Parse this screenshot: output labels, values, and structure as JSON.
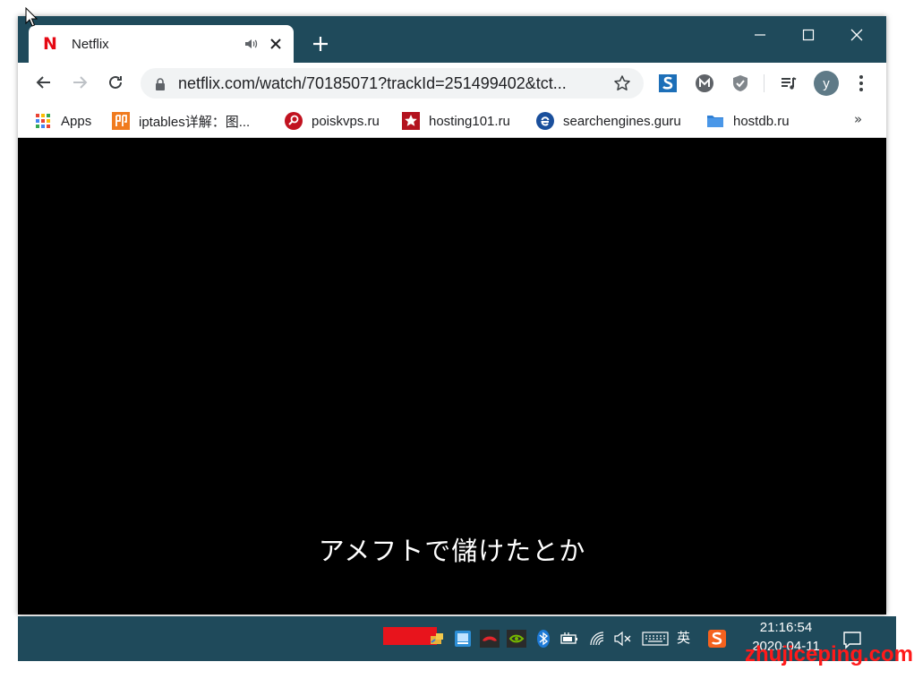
{
  "tab": {
    "title": "Netflix",
    "logo": "N"
  },
  "omnibox": {
    "url": "netflix.com/watch/70185071?trackId=251499402&tct..."
  },
  "profile": {
    "initial": "y"
  },
  "bookmarks": {
    "items": [
      {
        "label": "Apps",
        "icon": "apps-grid-icon"
      },
      {
        "label": "iptables详解：图...",
        "icon": "orange-badge-icon"
      },
      {
        "label": "poiskvps.ru",
        "icon": "red-search-icon"
      },
      {
        "label": "hosting101.ru",
        "icon": "red-star-icon"
      },
      {
        "label": "searchengines.guru",
        "icon": "blue-e-icon"
      },
      {
        "label": "hostdb.ru",
        "icon": "folder-icon"
      }
    ],
    "more": "»"
  },
  "video": {
    "subtitle": "アメフトで儲けたとか"
  },
  "taskbar": {
    "ime": "英",
    "time": "21:16:54",
    "date": "2020-04-11"
  },
  "watermark": "zhujiceping.com",
  "colors": {
    "frame": "#1f4a5b",
    "netflix_red": "#e50914",
    "toolbar_bg": "#ffffff",
    "omnibox_bg": "#f1f3f4",
    "content_bg": "#000000",
    "watermark": "#ff1a1a"
  }
}
